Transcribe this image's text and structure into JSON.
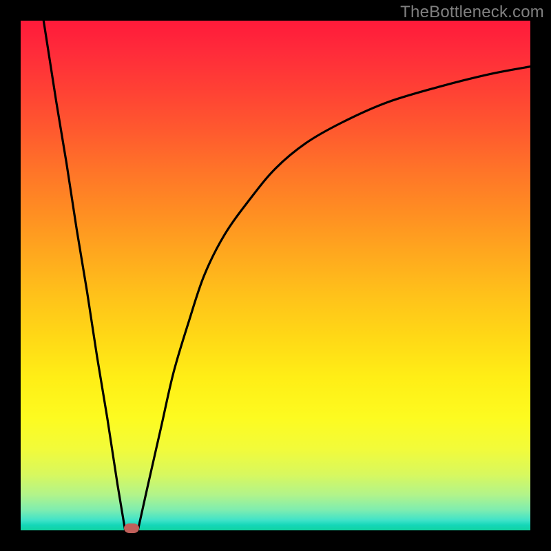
{
  "watermark": "TheBottleneck.com",
  "colors": {
    "frame": "#000000",
    "curve": "#000000",
    "marker": "#c1605a"
  },
  "chart_data": {
    "type": "line",
    "title": "",
    "xlabel": "",
    "ylabel": "",
    "xlim": [
      0,
      100
    ],
    "ylim": [
      0,
      100
    ],
    "note": "No axis ticks or labels are shown. X increases rightward, Y increases upward. Values are read off the pixel geometry of the two visible curve segments and normalized to 0–100.",
    "series": [
      {
        "name": "left-descent",
        "x": [
          4.5,
          7,
          9,
          11,
          13,
          15,
          17,
          19,
          20.5
        ],
        "y": [
          100,
          84,
          72,
          59,
          47,
          34,
          22,
          9,
          0
        ]
      },
      {
        "name": "right-ascent",
        "x": [
          23,
          25,
          27.5,
          30,
          33,
          36,
          40,
          45,
          50,
          56,
          63,
          72,
          82,
          92,
          100
        ],
        "y": [
          0,
          9,
          20,
          31,
          41,
          50,
          58,
          65,
          71,
          76,
          80,
          84,
          87,
          89.5,
          91
        ]
      }
    ],
    "marker": {
      "x": 21.7,
      "y": 0
    }
  }
}
